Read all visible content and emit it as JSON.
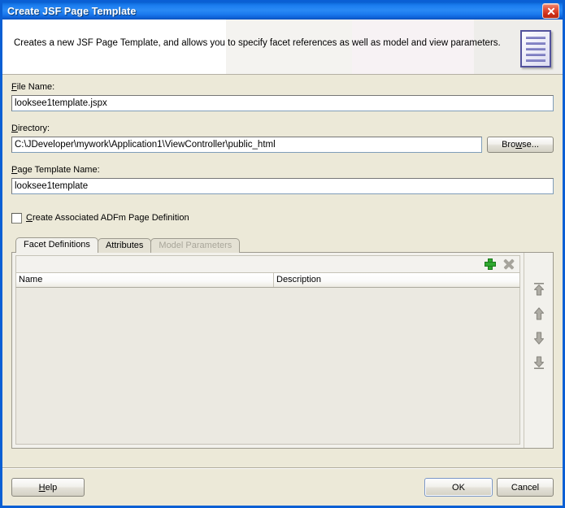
{
  "window": {
    "title": "Create JSF Page Template",
    "close_icon": "close-icon"
  },
  "header": {
    "description": "Creates a new JSF Page Template, and allows you to specify facet references as well as model and view parameters.",
    "icon": "page-template-document-icon"
  },
  "form": {
    "file_name": {
      "label": "File Name:",
      "mnemonic": "F",
      "value": "looksee1template.jspx",
      "placeholder": ""
    },
    "directory": {
      "label": "Directory:",
      "mnemonic": "D",
      "value": "C:\\JDeveloper\\mywork\\Application1\\ViewController\\public_html",
      "placeholder": "",
      "browse_label": "Browse...",
      "browse_mnemonic": "w"
    },
    "page_template_name": {
      "label": "Page Template Name:",
      "mnemonic": "P",
      "value": "looksee1template",
      "placeholder": ""
    },
    "adfm_checkbox": {
      "label": "Create Associated ADFm Page Definition",
      "mnemonic": "C",
      "checked": false
    }
  },
  "tabs": [
    {
      "label": "Facet Definitions",
      "selected": true,
      "disabled": false
    },
    {
      "label": "Attributes",
      "selected": false,
      "disabled": false
    },
    {
      "label": "Model Parameters",
      "selected": false,
      "disabled": true
    }
  ],
  "table": {
    "toolbar": [
      {
        "name": "add-row-icon",
        "glyph": "plus",
        "enabled": true
      },
      {
        "name": "delete-row-icon",
        "glyph": "cross",
        "enabled": false
      }
    ],
    "columns": [
      "Name",
      "Description"
    ],
    "rows": []
  },
  "move_buttons": [
    {
      "name": "move-to-top-button",
      "icon": "arrow-up-to-line-icon"
    },
    {
      "name": "move-up-button",
      "icon": "arrow-up-icon"
    },
    {
      "name": "move-down-button",
      "icon": "arrow-down-icon"
    },
    {
      "name": "move-to-bottom-button",
      "icon": "arrow-down-to-line-icon"
    }
  ],
  "footer": {
    "help_label": "Help",
    "help_mnemonic": "H",
    "ok_label": "OK",
    "cancel_label": "Cancel"
  },
  "colors": {
    "titlebar_blue": "#1d7ef0",
    "dialog_border": "#0a5fd4",
    "dialog_face": "#ece9d8",
    "panel_face": "#f2f1ec",
    "field_border": "#7f9db9",
    "add_green": "#2fa82f",
    "disabled_grey": "#a6a49c",
    "focus_blue": "#7a96c6"
  }
}
